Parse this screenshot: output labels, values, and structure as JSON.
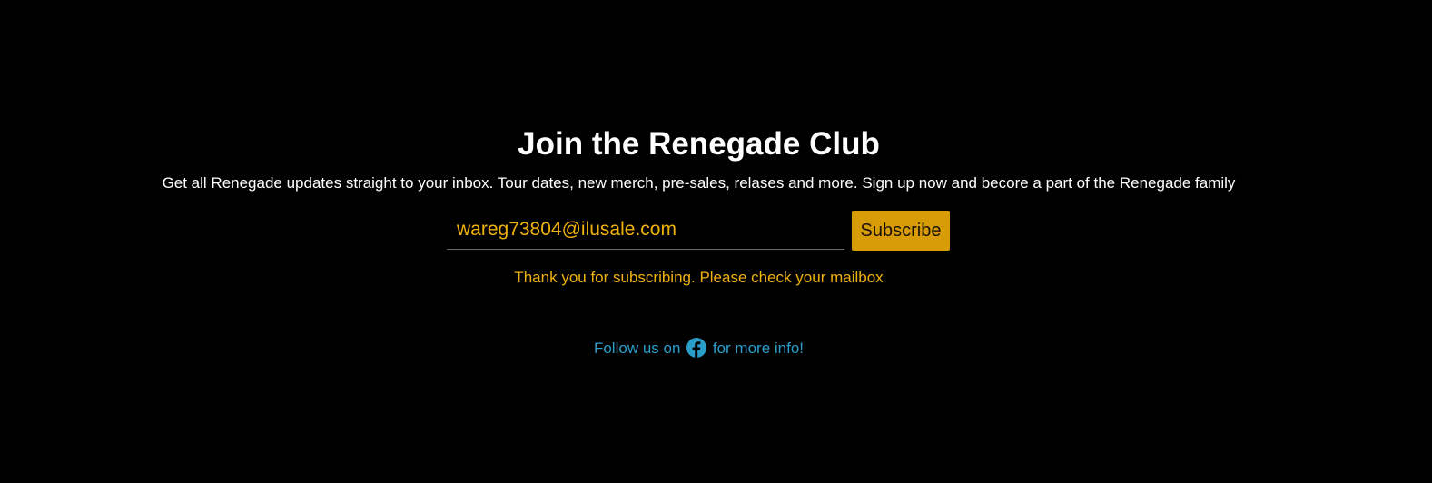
{
  "signup": {
    "title": "Join the Renegade Club",
    "description": "Get all Renegade updates straight to your inbox. Tour dates, new merch, pre-sales, relases and more. Sign up now and becore a part of the Renegade family",
    "email_value": "wareg73804@ilusale.com",
    "subscribe_label": "Subscribe",
    "success_message": "Thank you for subscribing. Please check your mailbox"
  },
  "follow": {
    "prefix": "Follow us on",
    "suffix": "for more info!",
    "icon": "facebook-icon"
  },
  "colors": {
    "background": "#000000",
    "accent": "#d79c08",
    "input_text": "#f0b30c",
    "link": "#2b9dc9"
  }
}
